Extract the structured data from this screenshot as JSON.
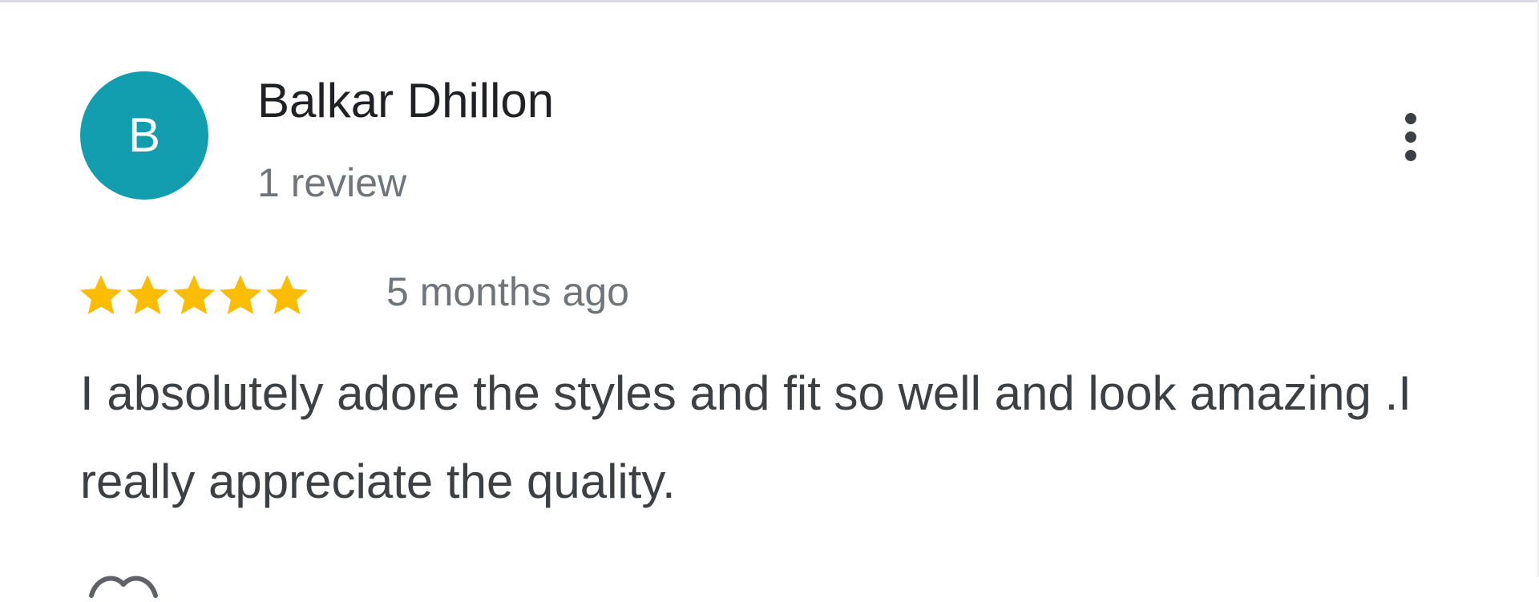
{
  "review": {
    "avatar_initial": "B",
    "reviewer_name": "Balkar Dhillon",
    "review_count": "1 review",
    "rating": 5,
    "rating_max": 5,
    "date": "5 months ago",
    "text": "I absolutely adore the styles and fit so well and look amazing .I really appreciate the quality.",
    "more_options_icon": "more-vert-icon",
    "star_icon": "star-icon"
  },
  "colors": {
    "avatar_bg": "#129eaf",
    "star_fill": "#fbbc04",
    "name_text": "#202124",
    "meta_text": "#70757a",
    "body_text": "#3c4043"
  }
}
